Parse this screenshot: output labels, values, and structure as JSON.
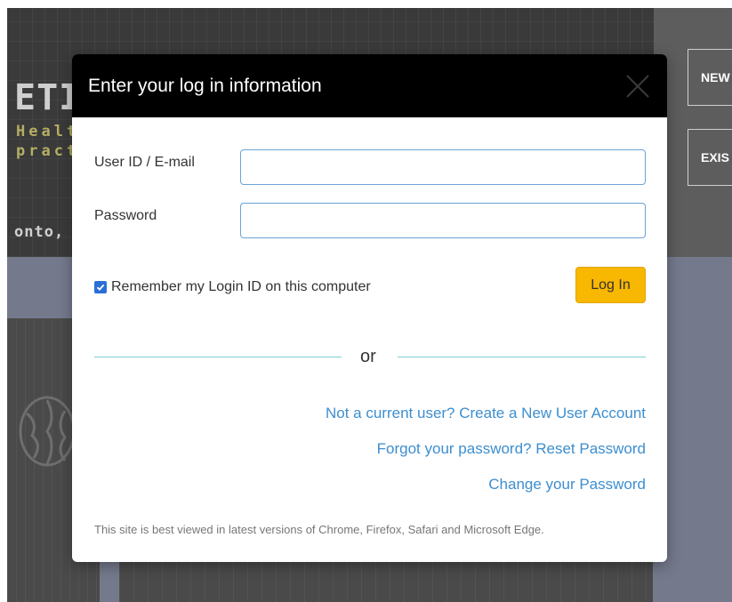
{
  "background": {
    "banner_title": "ETIN",
    "banner_subtitle_line1": "Healt",
    "banner_subtitle_line2": "pract",
    "banner_location": "onto, C",
    "nav_buttons": [
      "NEW",
      "EXIS"
    ]
  },
  "modal": {
    "title": "Enter your log in information",
    "fields": {
      "user_label": "User ID / E-mail",
      "user_value": "",
      "password_label": "Password",
      "password_value": ""
    },
    "remember": {
      "label": "Remember my Login ID on this computer",
      "checked": true
    },
    "login_button": "Log In",
    "divider_text": "or",
    "links": {
      "create_account": "Not a current user? Create a New User Account",
      "reset_password": "Forgot your password? Reset Password",
      "change_password": "Change your Password"
    },
    "footer_note": "This site is best viewed in latest versions of Chrome, Firefox, Safari and Microsoft Edge."
  },
  "colors": {
    "header_bg": "#000000",
    "login_button": "#f8b700",
    "link": "#3d8ecf",
    "divider": "#7fcfd0",
    "input_border": "#6aa3d8",
    "checkbox": "#2a6fd6"
  }
}
